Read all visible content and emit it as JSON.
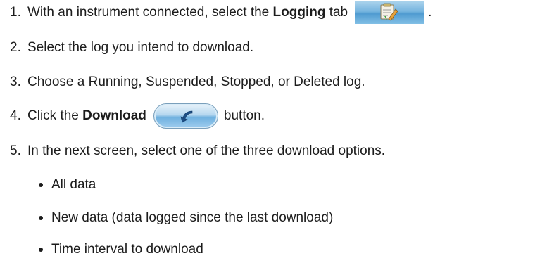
{
  "steps": [
    {
      "num": "1.",
      "text_before": "With an instrument connected, select the ",
      "bold": "Logging",
      "text_after": " tab",
      "trailing": "."
    },
    {
      "num": "2.",
      "text": "Select the log you intend to download."
    },
    {
      "num": "3.",
      "text": "Choose a Running, Suspended, Stopped, or Deleted log."
    },
    {
      "num": "4.",
      "text_before": "Click the ",
      "bold": "Download",
      "text_after": "button."
    },
    {
      "num": "5.",
      "text": "In the next screen, select one of the three download options."
    }
  ],
  "options": [
    "All data",
    "New data (data logged since the last download)",
    "Time interval to download"
  ],
  "icons": {
    "logging_tab": "logging-tab-icon",
    "download_button": "download-arrow-icon"
  }
}
